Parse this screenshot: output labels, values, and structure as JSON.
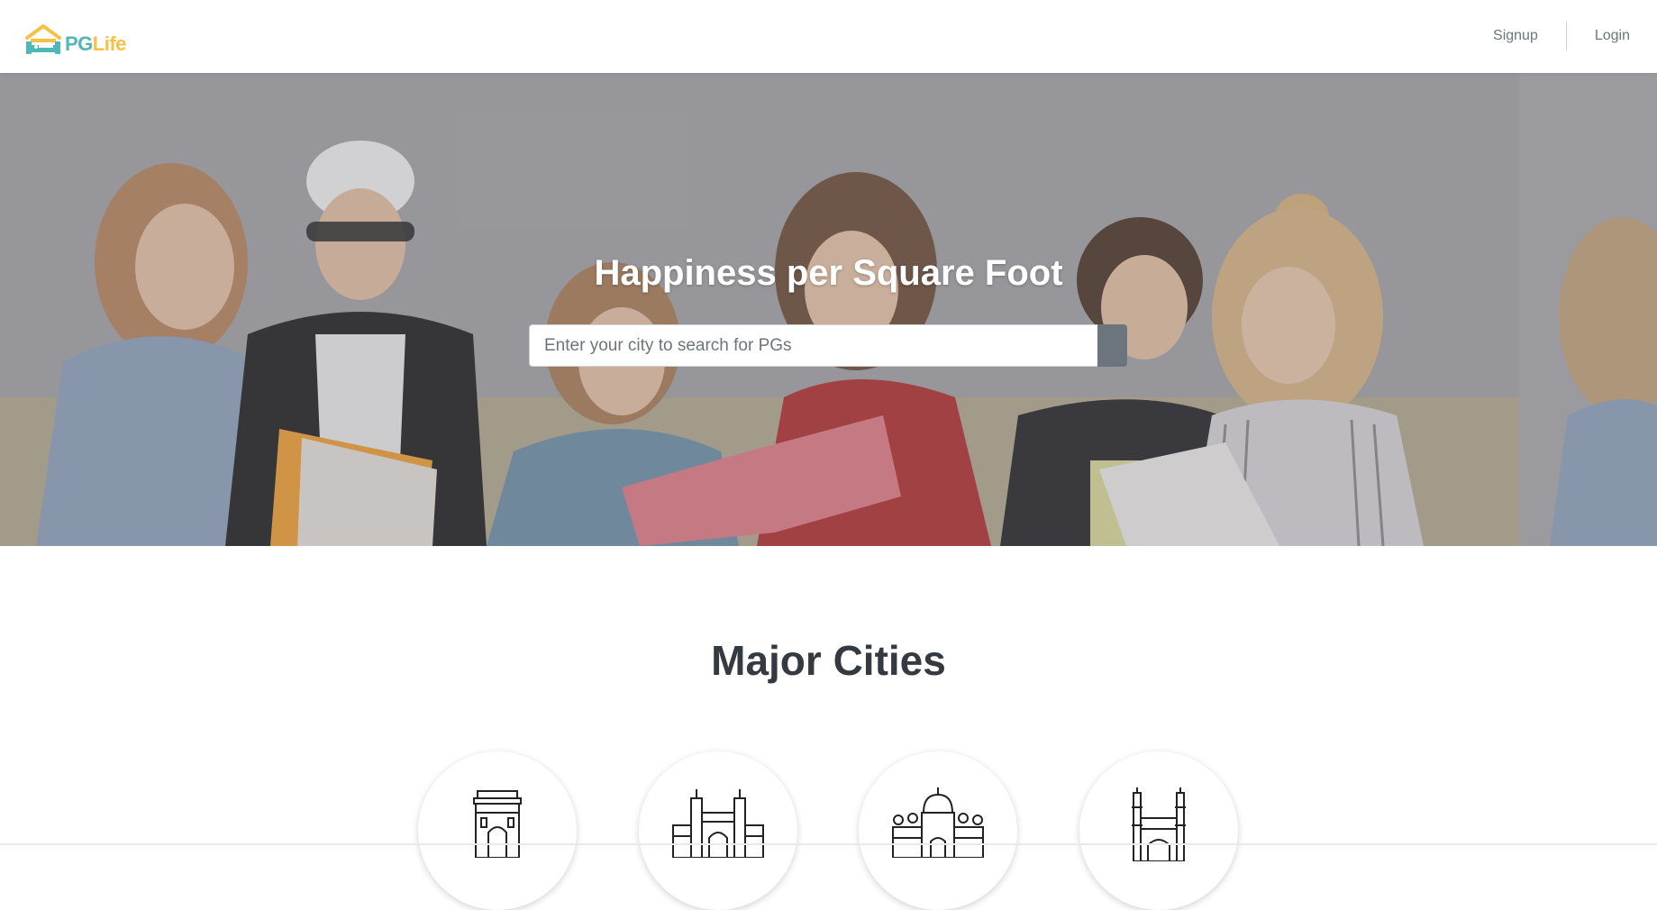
{
  "brand": {
    "name_part1": "PG",
    "name_part2": "Life",
    "logo_icon": "house-bed-icon",
    "colors": {
      "teal": "#4fb7b5",
      "yellow": "#f7c144"
    }
  },
  "nav": {
    "signup": "Signup",
    "login": "Login"
  },
  "hero": {
    "title": "Happiness per Square Foot",
    "search_placeholder": "Enter your city to search for PGs",
    "search_icon": "search-icon"
  },
  "major_cities": {
    "title": "Major Cities",
    "items": [
      {
        "icon": "india-gate-icon"
      },
      {
        "icon": "gateway-of-india-icon"
      },
      {
        "icon": "palace-dome-icon"
      },
      {
        "icon": "charminar-icon"
      }
    ]
  },
  "colors": {
    "button_gray": "#6c757d",
    "text_dark": "#343a40",
    "nav_text": "#6c757d"
  }
}
